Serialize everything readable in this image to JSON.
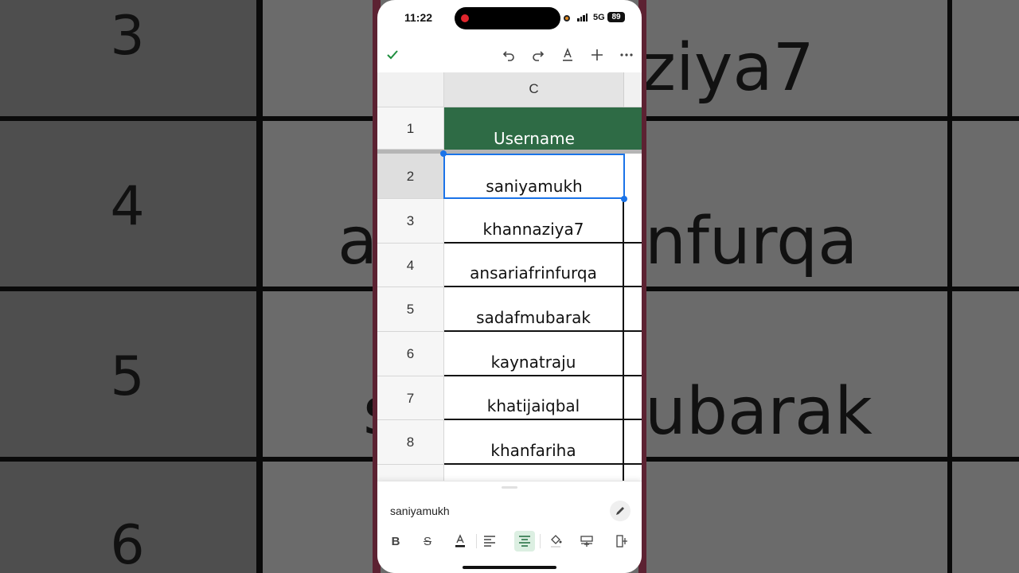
{
  "status_bar": {
    "time": "11:22",
    "network": "5G",
    "battery": "89"
  },
  "column_header": "C",
  "header_row": {
    "row": "1",
    "label": "Username"
  },
  "rows": [
    {
      "row": "2",
      "value": "saniyamukh"
    },
    {
      "row": "3",
      "value": "khannaziya7"
    },
    {
      "row": "4",
      "value": "ansariafrinfurqa"
    },
    {
      "row": "5",
      "value": "sadafmubarak"
    },
    {
      "row": "6",
      "value": "kaynatraju"
    },
    {
      "row": "7",
      "value": "khatijaiqbal"
    },
    {
      "row": "8",
      "value": "khanfariha"
    }
  ],
  "formula_bar": {
    "value": "saniyamukh"
  },
  "background_zoom": {
    "row_numbers": [
      "3",
      "4",
      "5",
      "6"
    ],
    "fragments": [
      "ziya7",
      "a",
      "nfurqa",
      "s",
      "ubarak"
    ]
  },
  "colors": {
    "header_fill": "#2e6b45",
    "selection": "#1a73e8",
    "accent": "#1e6b3c"
  }
}
